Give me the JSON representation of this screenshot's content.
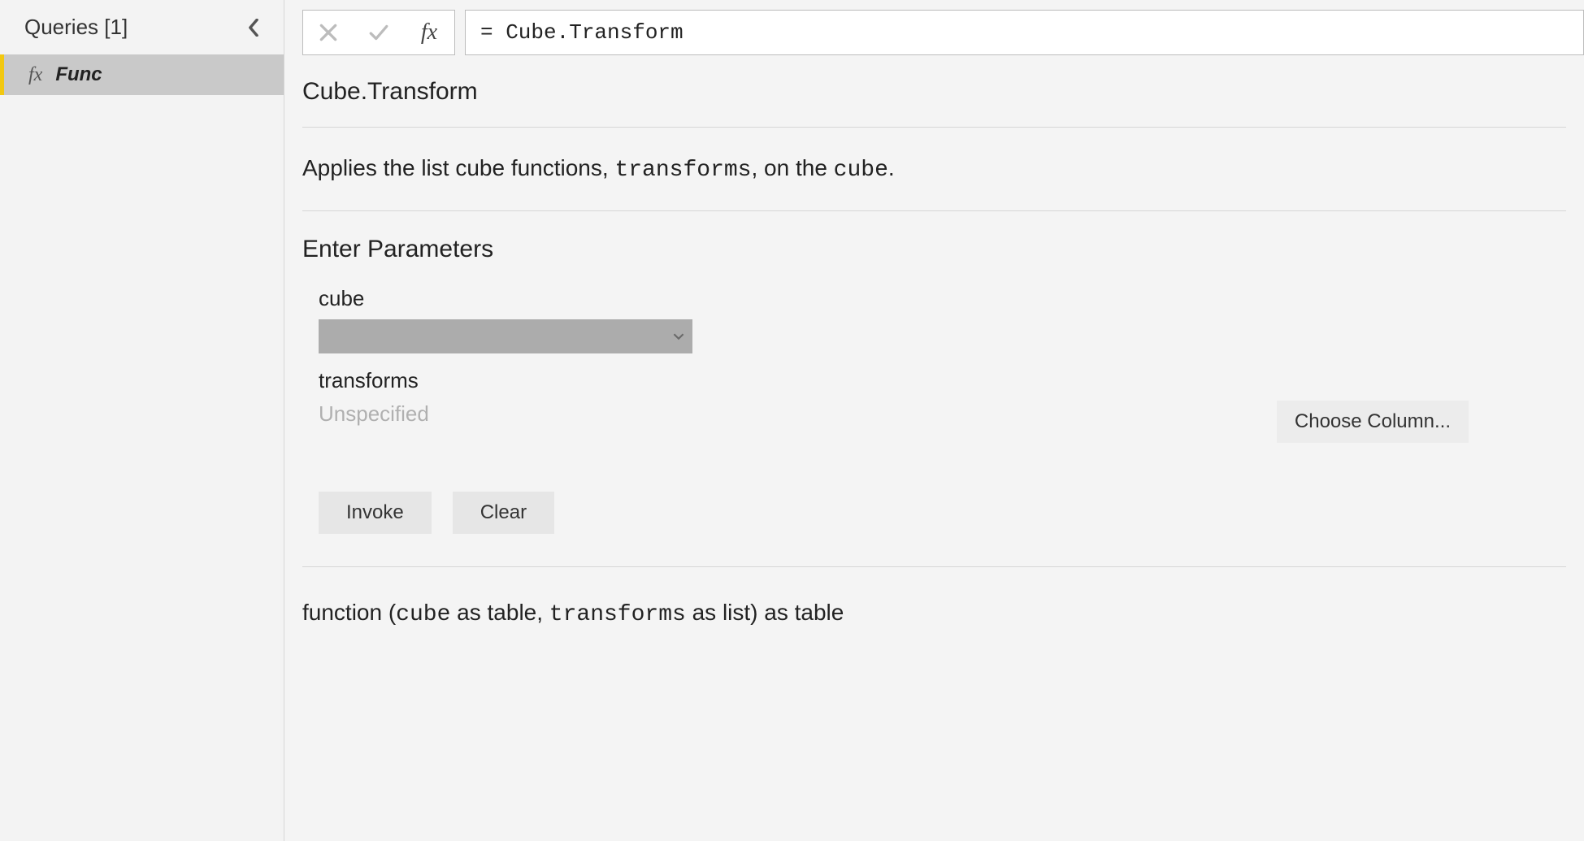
{
  "sidebar": {
    "title": "Queries [1]",
    "items": [
      {
        "icon": "fx",
        "label": "Func"
      }
    ]
  },
  "formulaBar": {
    "value": "= Cube.Transform"
  },
  "func": {
    "name": "Cube.Transform",
    "descPrefix": "Applies the list cube functions, ",
    "descCode1": "transforms",
    "descMid": ", on the ",
    "descCode2": "cube",
    "descSuffix": "."
  },
  "params": {
    "heading": "Enter Parameters",
    "p1Label": "cube",
    "p2Label": "transforms",
    "p2Value": "Unspecified",
    "chooseColumn": "Choose Column...",
    "invoke": "Invoke",
    "clear": "Clear"
  },
  "signature": {
    "w1": "function (",
    "c1": "cube",
    "w2": " as table, ",
    "c2": "transforms",
    "w3": " as list) as table"
  }
}
